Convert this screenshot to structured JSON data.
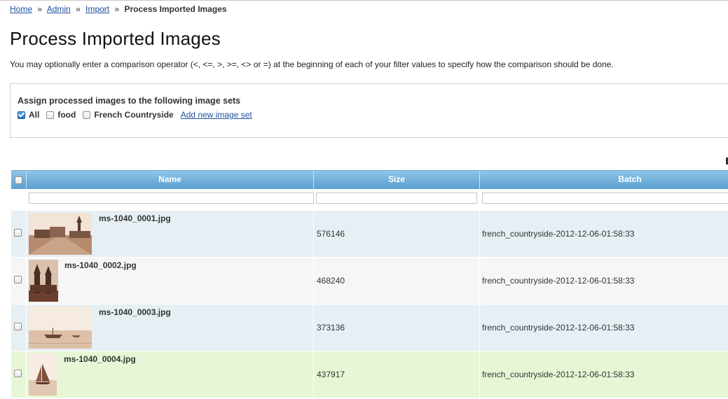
{
  "breadcrumb": {
    "home": "Home",
    "sep": "»",
    "admin": "Admin",
    "import": "Import",
    "current": "Process Imported Images"
  },
  "page": {
    "title": "Process Imported Images",
    "intro": "You may optionally enter a comparison operator (<, <=, >, >=, <> or =) at the beginning of each of your filter values to specify how the comparison should be done."
  },
  "image_sets": {
    "title": "Assign processed images to the following image sets",
    "options": [
      {
        "label": "All",
        "checked": true
      },
      {
        "label": "food",
        "checked": false
      },
      {
        "label": "French Countryside",
        "checked": false
      }
    ],
    "add_link": "Add new image set"
  },
  "table": {
    "columns": [
      "Name",
      "Size",
      "Batch"
    ],
    "filters": [
      "",
      "",
      ""
    ],
    "rows": [
      {
        "name": "ms-1040_0001.jpg",
        "size": "576146",
        "batch": "french_countryside-2012-12-06-01:58:33",
        "bg": "#e6eff4",
        "thumb": "village-street-photo"
      },
      {
        "name": "ms-1040_0002.jpg",
        "size": "468240",
        "batch": "french_countryside-2012-12-06-01:58:33",
        "bg": "#f6f6f6",
        "thumb": "church-towers-photo"
      },
      {
        "name": "ms-1040_0003.jpg",
        "size": "373136",
        "batch": "french_countryside-2012-12-06-01:58:33",
        "bg": "#e6eff4",
        "thumb": "boats-on-water-photo"
      },
      {
        "name": "ms-1040_0004.jpg",
        "size": "437917",
        "batch": "french_countryside-2012-12-06-01:58:33",
        "bg": "#e7f7d6",
        "thumb": "sailboat-photo"
      }
    ]
  },
  "colors": {
    "header_top": "#8ec4e6",
    "header_bottom": "#5a9fd1",
    "link": "#1f4fa0",
    "row_selected": "#e7f7d6"
  }
}
